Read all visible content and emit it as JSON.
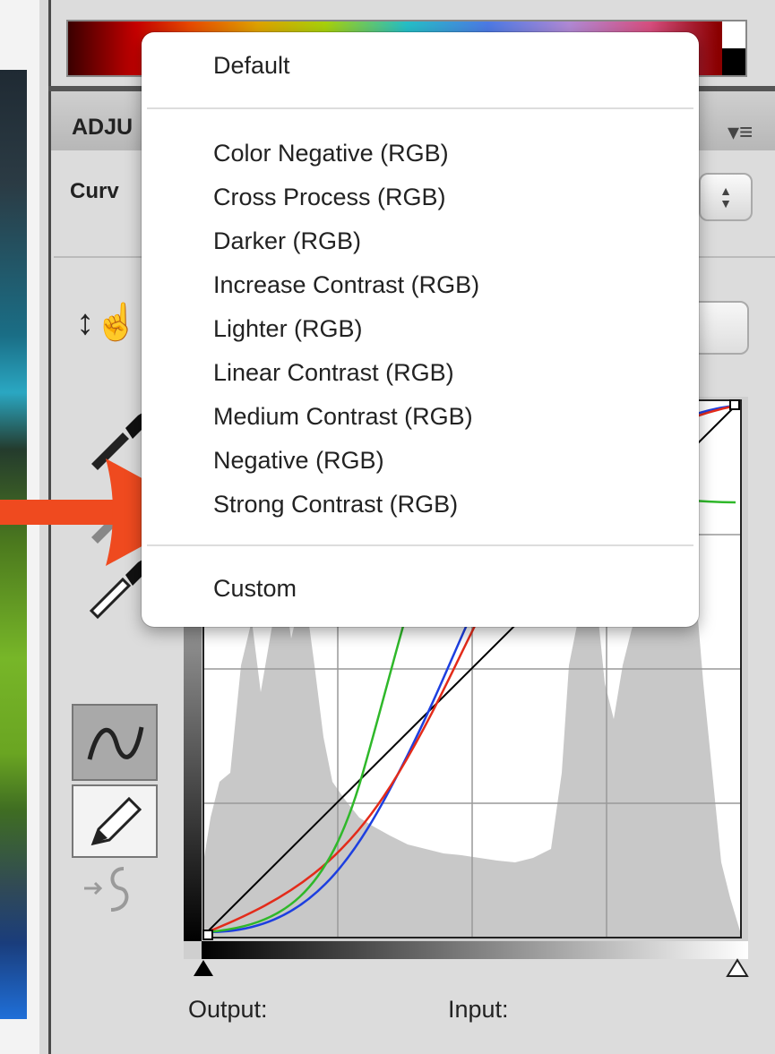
{
  "panel": {
    "title": "ADJU",
    "curves_label": "Curv",
    "menu_icon": "panel-menu-icon",
    "preset_select_arrows": "updown-arrows-icon"
  },
  "preset_menu": {
    "default": "Default",
    "items": [
      "Color Negative (RGB)",
      "Cross Process (RGB)",
      "Darker (RGB)",
      "Increase Contrast (RGB)",
      "Lighter (RGB)",
      "Linear Contrast (RGB)",
      "Medium Contrast (RGB)",
      "Negative (RGB)",
      "Strong Contrast (RGB)"
    ],
    "custom": "Custom"
  },
  "graph": {
    "output_label": "Output:",
    "input_label": "Input:"
  },
  "colors": {
    "arrow": "#ef4a1f",
    "curve_red": "#e32b1a",
    "curve_green": "#2fb82a",
    "curve_blue": "#1d3fe0",
    "curve_composite": "#000000",
    "histogram": "#c8c8c8"
  }
}
